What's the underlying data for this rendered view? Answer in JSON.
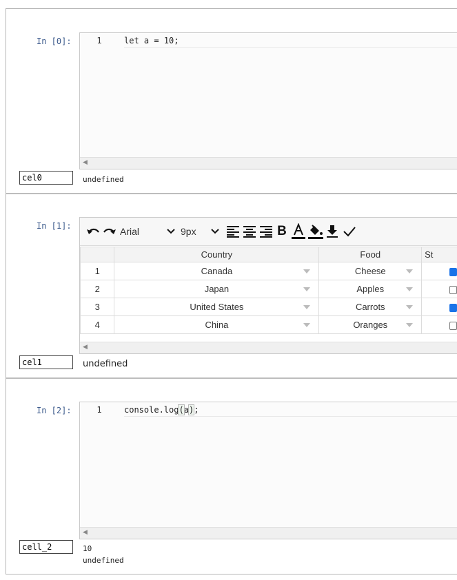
{
  "cells": [
    {
      "prompt": "In [0]:",
      "name": "cel0",
      "lines": [
        {
          "number": "1",
          "code": "let a = 10;"
        }
      ],
      "output": "undefined"
    },
    {
      "prompt": "In [1]:",
      "name": "cel1",
      "toolbar": {
        "font": "Arial",
        "size": "9px",
        "icons": [
          "undo-icon",
          "redo-icon",
          "font-select",
          "font-size-select",
          "align-left-icon",
          "align-center-icon",
          "align-right-icon",
          "bold-icon",
          "text-color-icon",
          "fill-color-icon",
          "download-icon",
          "check-icon"
        ]
      },
      "table": {
        "headers": [
          "",
          "Country",
          "Food",
          "St"
        ],
        "rows": [
          {
            "num": "1",
            "country": "Canada",
            "food": "Cheese",
            "stock": true
          },
          {
            "num": "2",
            "country": "Japan",
            "food": "Apples",
            "stock": false
          },
          {
            "num": "3",
            "country": "United States",
            "food": "Carrots",
            "stock": true
          },
          {
            "num": "4",
            "country": "China",
            "food": "Oranges",
            "stock": false
          }
        ]
      },
      "output": "undefined"
    },
    {
      "prompt": "In [2]:",
      "name": "cell_2",
      "lines": [
        {
          "number": "1",
          "code_pre": "console.log",
          "code_open": "(",
          "code_arg": "a",
          "code_close": ")",
          "code_post": ";"
        }
      ],
      "output": "10\nundefined"
    }
  ]
}
